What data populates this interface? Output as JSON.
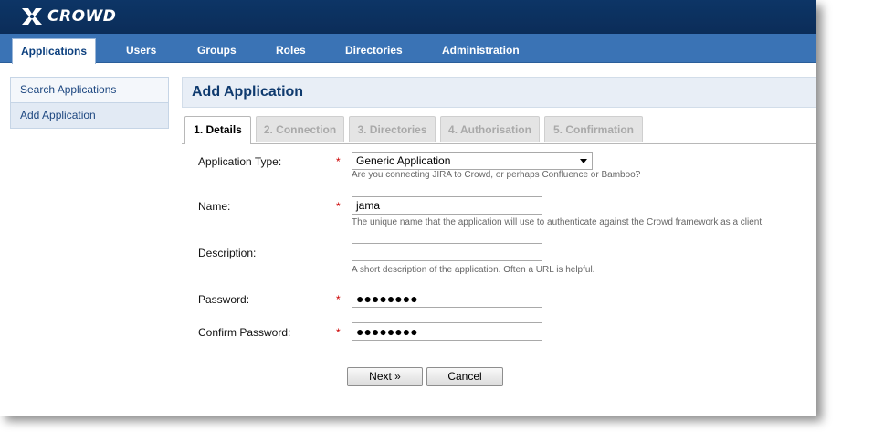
{
  "header": {
    "logo_text": "CROWD",
    "logo_icon": "crowd-logo-icon"
  },
  "nav": {
    "tabs": [
      {
        "label": "Applications",
        "active": true
      },
      {
        "label": "Users"
      },
      {
        "label": "Groups"
      },
      {
        "label": "Roles"
      },
      {
        "label": "Directories"
      },
      {
        "label": "Administration"
      }
    ]
  },
  "sidebar": {
    "items": [
      {
        "label": "Search Applications"
      },
      {
        "label": "Add Application",
        "active": true
      }
    ]
  },
  "page": {
    "title": "Add Application"
  },
  "wizard": {
    "steps": [
      {
        "label": "1. Details",
        "active": true
      },
      {
        "label": "2. Connection"
      },
      {
        "label": "3. Directories"
      },
      {
        "label": "4. Authorisation"
      },
      {
        "label": "5. Confirmation"
      }
    ]
  },
  "form": {
    "application_type": {
      "label": "Application Type:",
      "required": "*",
      "value": "Generic Application",
      "help": "Are you connecting JIRA to Crowd, or perhaps Confluence or Bamboo?"
    },
    "name": {
      "label": "Name:",
      "required": "*",
      "value": "jama",
      "help": "The unique name that the application will use to authenticate against the Crowd framework as a client."
    },
    "description": {
      "label": "Description:",
      "value": "",
      "help": "A short description of the application. Often a URL is helpful."
    },
    "password": {
      "label": "Password:",
      "required": "*",
      "value": "●●●●●●●●"
    },
    "confirm_password": {
      "label": "Confirm Password:",
      "required": "*",
      "value": "●●●●●●●●"
    }
  },
  "buttons": {
    "next": "Next »",
    "cancel": "Cancel"
  },
  "colors": {
    "header": "#0b2d59",
    "navbar": "#3a73b5",
    "required": "#cc0000",
    "title": "#0f3a6e"
  }
}
